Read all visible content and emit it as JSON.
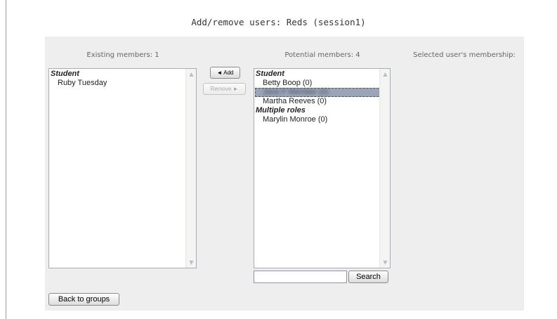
{
  "page": {
    "title": "Add/remove users: Reds (session1)"
  },
  "existing": {
    "label": "Existing members: 1",
    "groups": [
      {
        "name": "Student",
        "members": [
          "Ruby Tuesday"
        ]
      }
    ]
  },
  "potential": {
    "label": "Potential members: 4",
    "group1": {
      "name": "Student",
      "members": [
        "Betty Boop (0)",
        "Jane F Member (0)",
        "Martha Reeves (0)"
      ]
    },
    "group2": {
      "name": "Multiple roles",
      "members": [
        "Marylin Monroe (0)"
      ]
    }
  },
  "membership": {
    "label": "Selected user's membership:"
  },
  "buttons": {
    "add": "◄ Add",
    "remove": "Remove ►",
    "search": "Search",
    "back": "Back to groups"
  },
  "search": {
    "value": "",
    "placeholder": ""
  }
}
